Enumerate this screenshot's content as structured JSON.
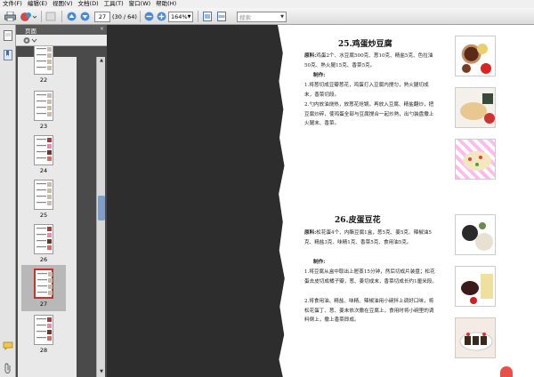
{
  "menu": [
    "文件(F)",
    "编辑(E)",
    "视图(V)",
    "文档(D)",
    "工具(T)",
    "窗口(W)",
    "帮助(H)"
  ],
  "toolbar": {
    "page_current": "27",
    "page_total": "(30 / 64)",
    "zoom": "164%",
    "search_placeholder": "搜索"
  },
  "panel": {
    "title": "页面"
  },
  "thumbnails": [
    {
      "label": "22"
    },
    {
      "label": "23"
    },
    {
      "label": "24"
    },
    {
      "label": "25"
    },
    {
      "label": "26"
    },
    {
      "label": "27"
    },
    {
      "label": "28"
    }
  ],
  "recipes": [
    {
      "title": "25.鸡蛋炒豆腐",
      "ingredients_label": "原料:",
      "ingredients": "鸡蛋2个、水豆腐500克、葱10克、精盐5克、色拉油50克、熟火腿15克、香菜5克。",
      "method_label": "制作:",
      "steps": [
        "1.将葱切成豆瓣葱花，鸡蛋打入豆腐内搅匀，熟火腿切成末，香菜切段。",
        "2.勺内放油烧热，放葱花炝锅，再放入豆腐、精盐翻炒，把豆腐炒碎，使鸡蛋全部与豆腐搅合一起炒熟，出勺装盘撒上火腿末、香菜。"
      ]
    },
    {
      "title": "26.皮蛋豆花",
      "ingredients_label": "原料:",
      "ingredients": "松花蛋4个、内酯豆腐1盒，葱5克、姜5克、辣椒油5克、精盐3克、味精1克、香菜5克、食用油5克。",
      "method_label": "制作:",
      "steps": [
        "1.将豆腐从盒中取出上屉蒸15分钟，然后切成片装盘；松花蛋去皮切成橘子瓣，葱、姜切成末，香菜切成长约1厘米段。",
        "2.将食用油、精盐、味精、辣椒油用小碗拌上调好口味，将松花蛋丁、葱、姜末依次撒在豆腐上，食用时将小碗里的调料倒上，撒上香菜即成。"
      ]
    }
  ],
  "colors": {
    "accent": "#c8302a",
    "scroll": "#7f9fc8"
  }
}
